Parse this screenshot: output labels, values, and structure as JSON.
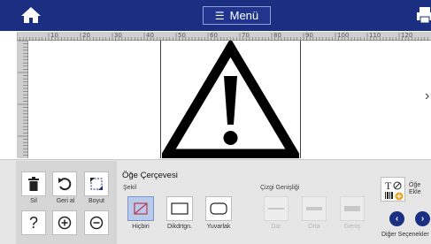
{
  "header": {
    "menu_label": "Menü",
    "menu_icon": "hamburger-icon",
    "home_icon": "home-icon",
    "print_icon": "printer-icon"
  },
  "ruler": {
    "top_numbers": [
      "10",
      "20",
      "30",
      "40",
      "50",
      "60",
      "70",
      "80",
      "90",
      "100",
      "110",
      "120",
      "130"
    ],
    "left_numbers": [
      "10",
      "20"
    ]
  },
  "canvas": {
    "object": "warning-triangle-icon"
  },
  "toolbar": {
    "delete_label": "Sil",
    "undo_label": "Geri al",
    "resize_label": "Boyut",
    "help_icon": "question-icon",
    "zoom_in_icon": "zoom-in-icon",
    "zoom_out_icon": "zoom-out-icon"
  },
  "frame_panel": {
    "title": "Öğe Çerçevesi",
    "shape_label": "Şekil",
    "shapes": [
      {
        "label": "Hiçbiri",
        "active": true
      },
      {
        "label": "Dikdrtgn.",
        "active": false
      },
      {
        "label": "Yuvarlak",
        "active": false
      }
    ],
    "line_width_label": "Çizgi Genişliği",
    "line_widths": [
      {
        "label": "Dar"
      },
      {
        "label": "Orta"
      },
      {
        "label": "Geniş"
      }
    ]
  },
  "right_panel": {
    "add_object_label_1": "Öğe",
    "add_object_label_2": "Ekle",
    "more_options_label": "Diğer Seçenekler"
  },
  "colors": {
    "header_bg": "#1a2e82",
    "active_shape_bg": "#b9cbea"
  }
}
